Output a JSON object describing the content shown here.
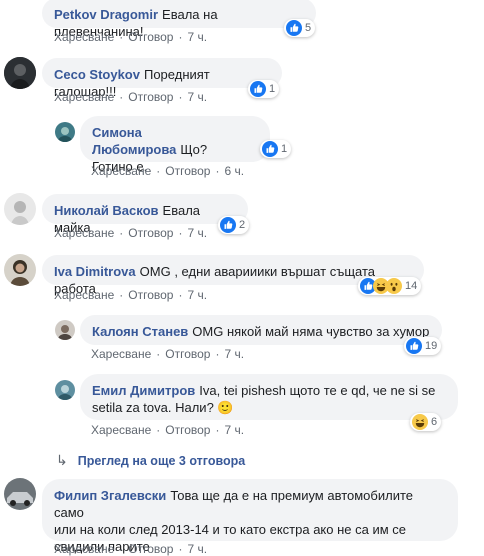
{
  "action_like": "Харесване",
  "action_reply": "Отговор",
  "dot": "·",
  "comments": [
    {
      "author": "Petkov Dragomir",
      "text": "Евала на плевенчанина!",
      "time": "7 ч.",
      "reactions": "5"
    },
    {
      "author": "Ceco Stoykov",
      "text": "Поредният галошар!!!",
      "time": "7 ч.",
      "reactions": "1"
    },
    {
      "author": "Симона Любомирова",
      "text": "Що?",
      "text2": "Готино е.",
      "time": "6 ч.",
      "reactions": "1"
    },
    {
      "author": "Николай Васков",
      "text": "Евала майка",
      "time": "7 ч.",
      "reactions": "2"
    },
    {
      "author": "Iva Dimitrova",
      "text": "OMG , едни аварииики вършат същата работа",
      "time": "7 ч.",
      "reactions": "14"
    },
    {
      "author": "Калоян Станев",
      "text": "OMG някой май няма чувство за хумор",
      "time": "7 ч.",
      "reactions": "19"
    },
    {
      "author": "Емил Димитров",
      "text": "Iva, tei pishesh щото те е qd, че ne si se",
      "text2": "setila za tova. Нали? 🙂",
      "time": "7 ч.",
      "reactions": "6"
    },
    {
      "author": "Филип Згалевски",
      "text": "Това ще да е на премиум автомобилите само",
      "text2": "или на коли след 2013-14 и то като екстра ако не са им се",
      "text3": "свидили парите",
      "time": "7 ч."
    }
  ],
  "more_replies": "Преглед на още 3 отговора",
  "colors": {
    "link": "#385898",
    "bubble": "#f2f3f5",
    "muted": "#606770",
    "like_blue": "#1877f2"
  }
}
